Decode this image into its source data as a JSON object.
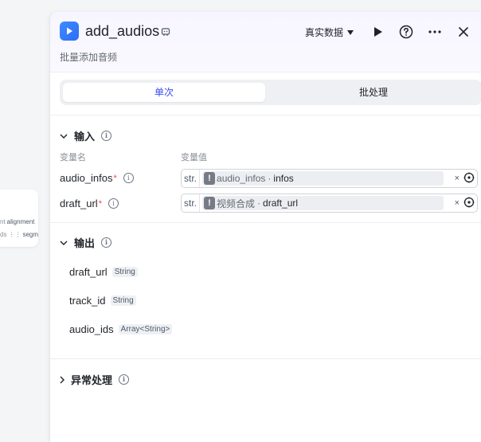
{
  "canvas": {
    "node_fragment": {
      "row1_tag": "nt",
      "row1_label": "alignment",
      "row2_tag": "ds",
      "row2_icon": "list-icon",
      "row2_label": "segment"
    }
  },
  "header": {
    "icon": "play-video-app-icon",
    "title": "add_audios",
    "subtitle": "批量添加音频",
    "data_select_label": "真实数据",
    "accent_color": "#3d4cf0"
  },
  "tabs": [
    {
      "label": "单次",
      "active": true
    },
    {
      "label": "批处理",
      "active": false
    }
  ],
  "input_section": {
    "title": "输入",
    "col_name": "变量名",
    "col_value": "变量值",
    "params": [
      {
        "name": "audio_infos",
        "required": true,
        "type": "str.",
        "source": "audio_infos",
        "field": "infos"
      },
      {
        "name": "draft_url",
        "required": true,
        "type": "str.",
        "source": "视频合成",
        "field": "draft_url"
      }
    ]
  },
  "output_section": {
    "title": "输出",
    "outputs": [
      {
        "name": "draft_url",
        "type": "String"
      },
      {
        "name": "track_id",
        "type": "String"
      },
      {
        "name": "audio_ids",
        "type": "Array<String>"
      }
    ]
  },
  "exception_section": {
    "title": "异常处理"
  },
  "required_mark": "*",
  "separator": "·",
  "clear_glyph": "×"
}
